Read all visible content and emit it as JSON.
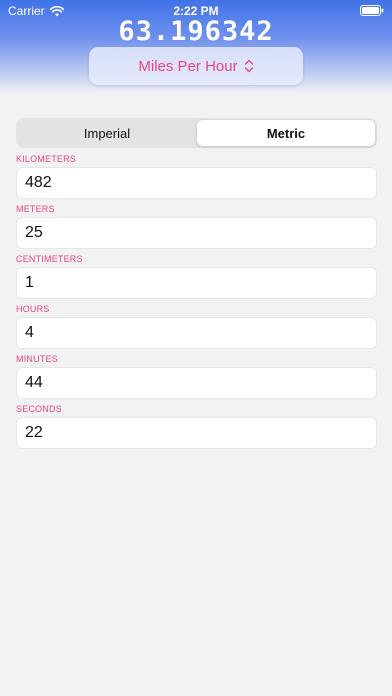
{
  "status_bar": {
    "carrier": "Carrier",
    "time": "2:22 PM"
  },
  "result": {
    "value": "63.196342",
    "unit": "Miles Per Hour"
  },
  "segments": {
    "left": "Imperial",
    "right": "Metric",
    "selected": "Metric"
  },
  "fields": [
    {
      "label": "KILOMETERS",
      "value": "482"
    },
    {
      "label": "METERS",
      "value": "25"
    },
    {
      "label": "CENTIMETERS",
      "value": "1"
    },
    {
      "label": "HOURS",
      "value": "4"
    },
    {
      "label": "MINUTES",
      "value": "44"
    },
    {
      "label": "SECONDS",
      "value": "22"
    }
  ],
  "colors": {
    "accent": "#e8467c",
    "header_top": "#3f73e8",
    "background": "#f2f2f4"
  },
  "icons": [
    "wifi-icon",
    "battery-icon",
    "chevron-updown-icon"
  ]
}
